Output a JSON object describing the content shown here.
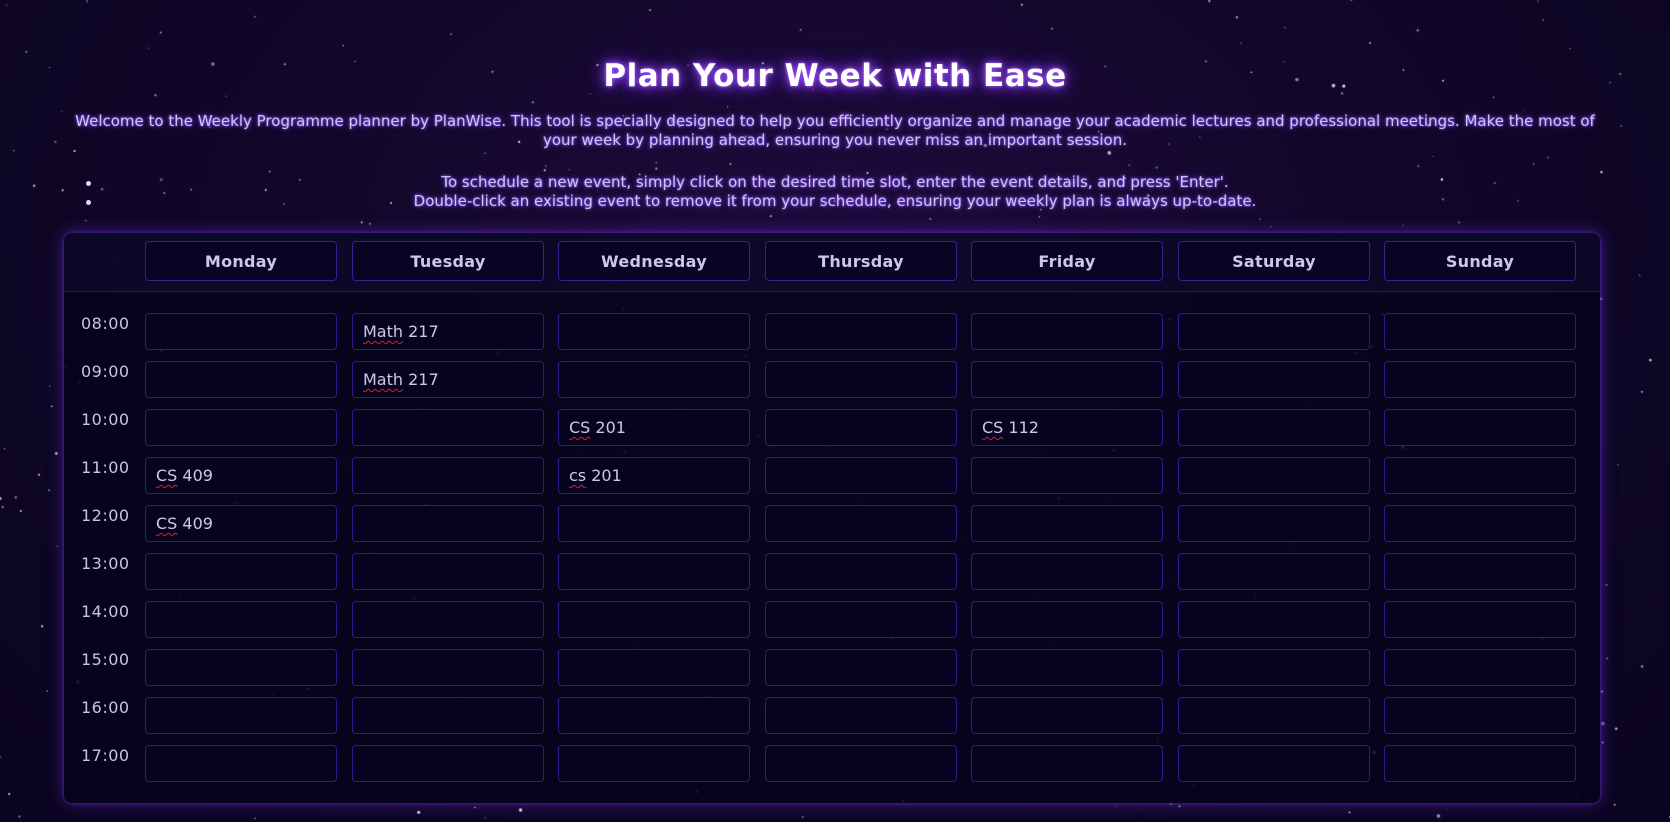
{
  "page": {
    "title": "Plan Your Week with Ease",
    "intro": "Welcome to the Weekly Programme planner by PlanWise. This tool is specially designed to help you efficiently organize and manage your academic lectures and professional meetings. Make the most of your week by planning ahead, ensuring you never miss an important session.",
    "instructions": [
      "To schedule a new event, simply click on the desired time slot, enter the event details, and press 'Enter'.",
      "Double-click an existing event to remove it from your schedule, ensuring your weekly plan is always up-to-date."
    ]
  },
  "colors": {
    "background": "#12072a",
    "accent_glow": "#7b2dff",
    "cell_border": "#35198a",
    "spellcheck_underline": "#e02020"
  },
  "planner": {
    "days": [
      "Monday",
      "Tuesday",
      "Wednesday",
      "Thursday",
      "Friday",
      "Saturday",
      "Sunday"
    ],
    "times": [
      "08:00",
      "09:00",
      "10:00",
      "11:00",
      "12:00",
      "13:00",
      "14:00",
      "15:00",
      "16:00",
      "17:00"
    ],
    "events": {
      "08:00": [
        "",
        "Math 217",
        "",
        "",
        "",
        "",
        ""
      ],
      "09:00": [
        "",
        "Math 217",
        "",
        "",
        "",
        "",
        ""
      ],
      "10:00": [
        "",
        "",
        "CS 201",
        "",
        "CS 112",
        "",
        ""
      ],
      "11:00": [
        "CS 409",
        "",
        "cs 201",
        "",
        "",
        "",
        ""
      ],
      "12:00": [
        "CS 409",
        "",
        "",
        "",
        "",
        "",
        ""
      ],
      "13:00": [
        "",
        "",
        "",
        "",
        "",
        "",
        ""
      ],
      "14:00": [
        "",
        "",
        "",
        "",
        "",
        "",
        ""
      ],
      "15:00": [
        "",
        "",
        "",
        "",
        "",
        "",
        ""
      ],
      "16:00": [
        "",
        "",
        "",
        "",
        "",
        "",
        ""
      ],
      "17:00": [
        "",
        "",
        "",
        "",
        "",
        "",
        ""
      ]
    }
  }
}
